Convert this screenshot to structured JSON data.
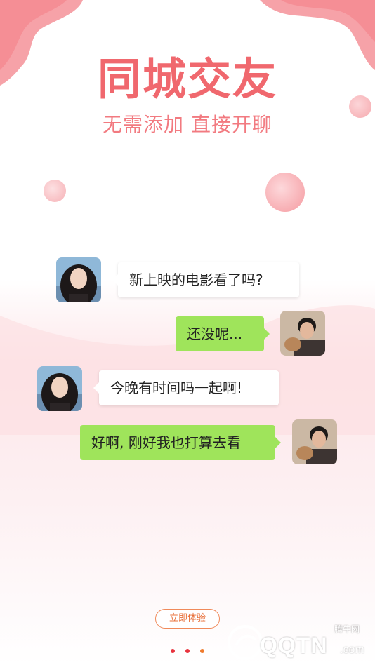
{
  "hero": {
    "title": "同城交友",
    "subtitle": "无需添加 直接开聊"
  },
  "chat": {
    "messages": [
      {
        "side": "left",
        "text": "新上映的电影看了吗?"
      },
      {
        "side": "right",
        "text": "还没呢..."
      },
      {
        "side": "left",
        "text": "今晚有时间吗一起啊!"
      },
      {
        "side": "right",
        "text": "好啊, 刚好我也打算去看"
      }
    ]
  },
  "cta": {
    "label": "立即体验"
  },
  "pager": {
    "total": 3,
    "active_index": 2
  },
  "watermark": {
    "logo_text": "QQTN",
    "suffix": ".com",
    "site_cn": "腾牛网"
  },
  "colors": {
    "accent": "#f0686e",
    "bubble_right": "#9fe45b",
    "cta": "#e8703a"
  }
}
